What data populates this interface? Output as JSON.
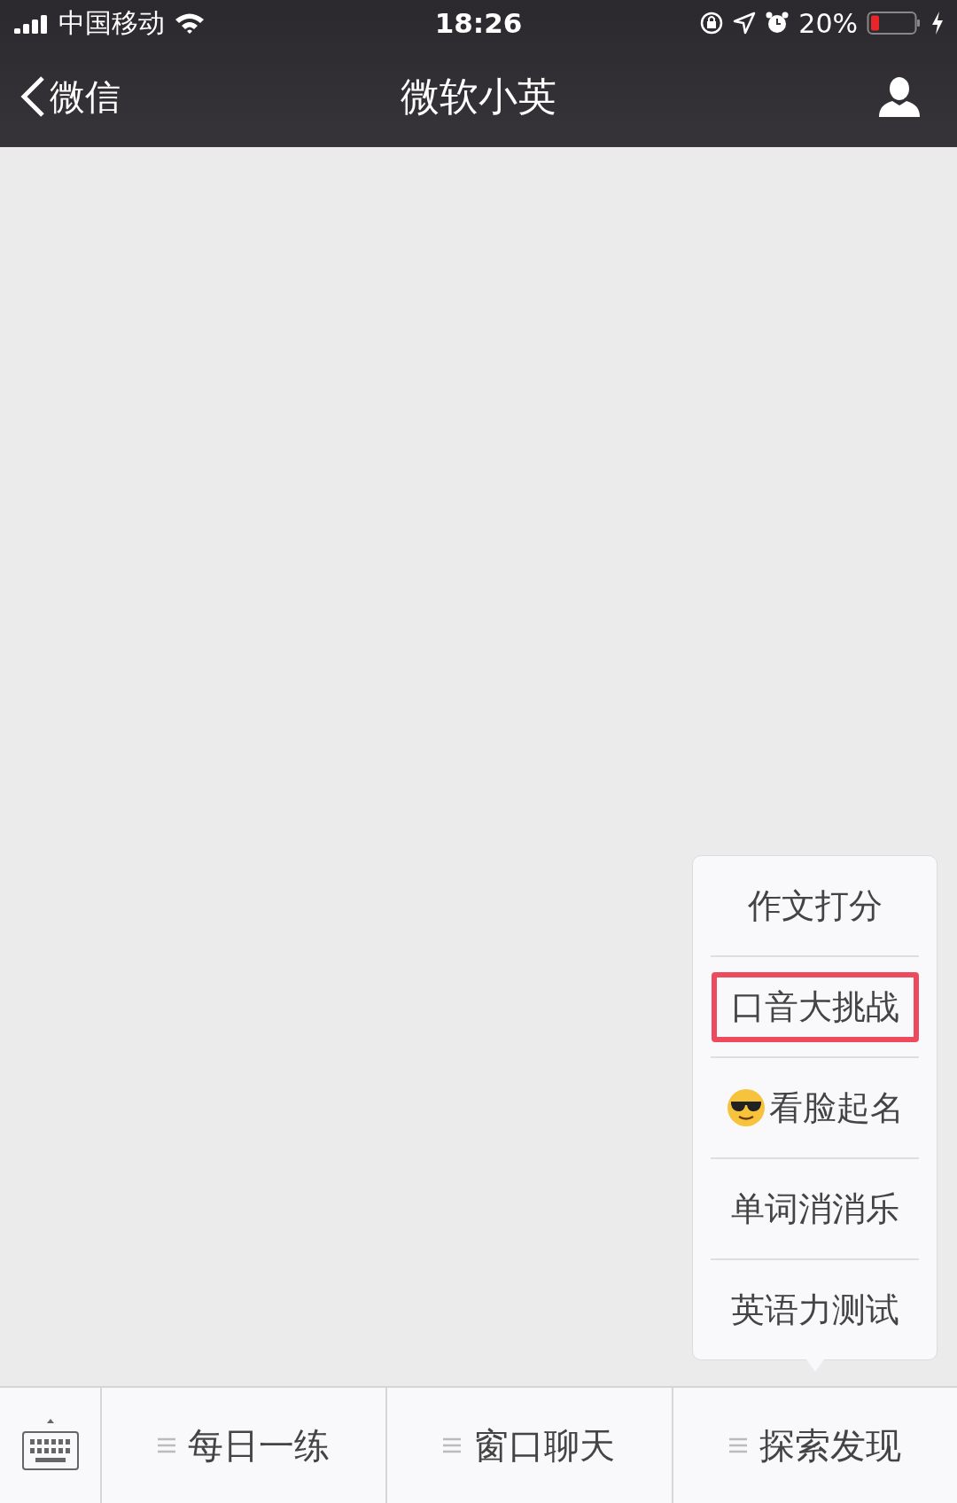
{
  "status_bar": {
    "carrier": "中国移动",
    "time": "18:26",
    "battery": "20%"
  },
  "nav_bar": {
    "back_label": "微信",
    "title": "微软小英"
  },
  "popup_menu": {
    "items": [
      {
        "label": "作文打分",
        "kind": "text",
        "highlighted": false
      },
      {
        "label": "口音大挑战",
        "kind": "text",
        "highlighted": true
      },
      {
        "label": "看脸起名",
        "kind": "emoji",
        "highlighted": false
      },
      {
        "label": "单词消消乐",
        "kind": "text",
        "highlighted": false
      },
      {
        "label": "英语力测试",
        "kind": "text",
        "highlighted": false
      }
    ]
  },
  "bottom_bar": {
    "tabs": [
      {
        "label": "每日一练"
      },
      {
        "label": "窗口聊天"
      },
      {
        "label": "探索发现"
      }
    ]
  }
}
